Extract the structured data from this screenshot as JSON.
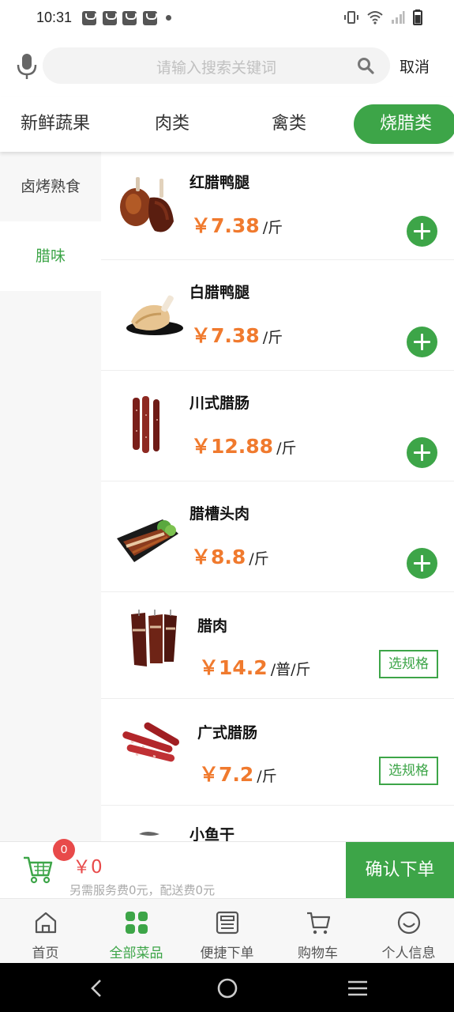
{
  "status_bar": {
    "time": "10:31"
  },
  "search": {
    "placeholder": "请输入搜索关键词",
    "cancel_label": "取消"
  },
  "tabs": [
    {
      "label": "新鲜蔬果"
    },
    {
      "label": "肉类"
    },
    {
      "label": "禽类"
    },
    {
      "label": "烧腊类",
      "active": true
    }
  ],
  "sidebar": {
    "items": [
      {
        "label": "卤烤熟食"
      },
      {
        "label": "腊味",
        "active": true
      }
    ]
  },
  "products": [
    {
      "name": "红腊鸭腿",
      "price": "￥7.38",
      "unit": "/斤",
      "action": "add"
    },
    {
      "name": "白腊鸭腿",
      "price": "￥7.38",
      "unit": "/斤",
      "action": "add"
    },
    {
      "name": "川式腊肠",
      "price": "￥12.88",
      "unit": "/斤",
      "action": "add"
    },
    {
      "name": "腊槽头肉",
      "price": "￥8.8",
      "unit": "/斤",
      "action": "add"
    },
    {
      "name": "腊肉",
      "price": "￥14.2",
      "unit": "/普/斤",
      "action": "spec",
      "action_label": "选规格"
    },
    {
      "name": "广式腊肠",
      "price": "￥7.2",
      "unit": "/斤",
      "action": "spec",
      "action_label": "选规格"
    },
    {
      "name": "小鱼干"
    }
  ],
  "cart": {
    "badge_count": "0",
    "total": "￥0",
    "fee_note": "另需服务费0元，配送费0元",
    "confirm_label": "确认下单"
  },
  "bottom_nav": [
    {
      "label": "首页",
      "icon": "home-icon"
    },
    {
      "label": "全部菜品",
      "icon": "grid-icon",
      "active": true
    },
    {
      "label": "便捷下单",
      "icon": "quick-order-icon"
    },
    {
      "label": "购物车",
      "icon": "cart-icon"
    },
    {
      "label": "个人信息",
      "icon": "smiley-icon"
    }
  ],
  "colors": {
    "accent": "#3da548",
    "price": "#f07a2e",
    "badge": "#e84a4a"
  }
}
